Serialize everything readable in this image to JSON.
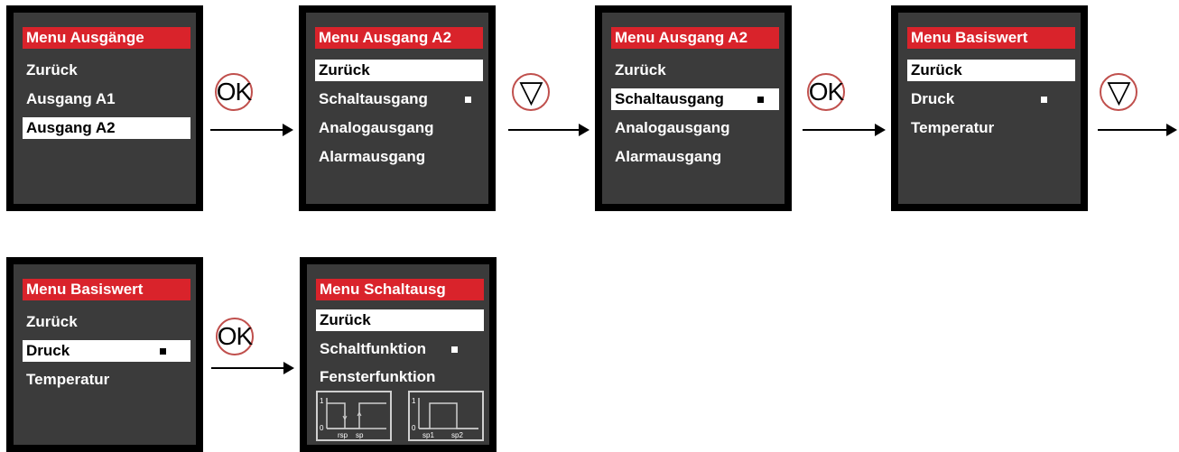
{
  "screens": [
    {
      "title": "Menu Ausgänge",
      "items": [
        "Zurück",
        "Ausgang A1",
        "Ausgang A2"
      ],
      "selected": 2
    },
    {
      "title": "Menu Ausgang A2",
      "items": [
        "Zurück",
        "Schaltausgang",
        "Analogausgang",
        "Alarmausgang"
      ],
      "selected": 0,
      "marked": 1
    },
    {
      "title": "Menu Ausgang A2",
      "items": [
        "Zurück",
        "Schaltausgang",
        "Analogausgang",
        "Alarmausgang"
      ],
      "selected": 1,
      "marked": 1
    },
    {
      "title": "Menu Basiswert",
      "items": [
        "Zurück",
        "Druck",
        "Temperatur"
      ],
      "selected": 0,
      "marked": 1
    },
    {
      "title": "Menu Basiswert",
      "items": [
        "Zurück",
        "Druck",
        "Temperatur"
      ],
      "selected": 1,
      "marked": 1
    },
    {
      "title": "Menu Schaltausg",
      "items": [
        "Zurück",
        "Schaltfunktion",
        "Fensterfunktion"
      ],
      "selected": 0,
      "marked": 1
    }
  ],
  "buttons": {
    "ok": "OK",
    "down": "▽"
  },
  "graphs": {
    "hysteresis": {
      "high": "1",
      "low": "0",
      "x1": "rsp",
      "x2": "sp"
    },
    "window": {
      "high": "1",
      "low": "0",
      "x1": "sp1",
      "x2": "sp2"
    }
  },
  "colors": {
    "title_bg": "#d9232b",
    "screen_bg": "#3b3b3b",
    "button_border": "#c0504d"
  }
}
